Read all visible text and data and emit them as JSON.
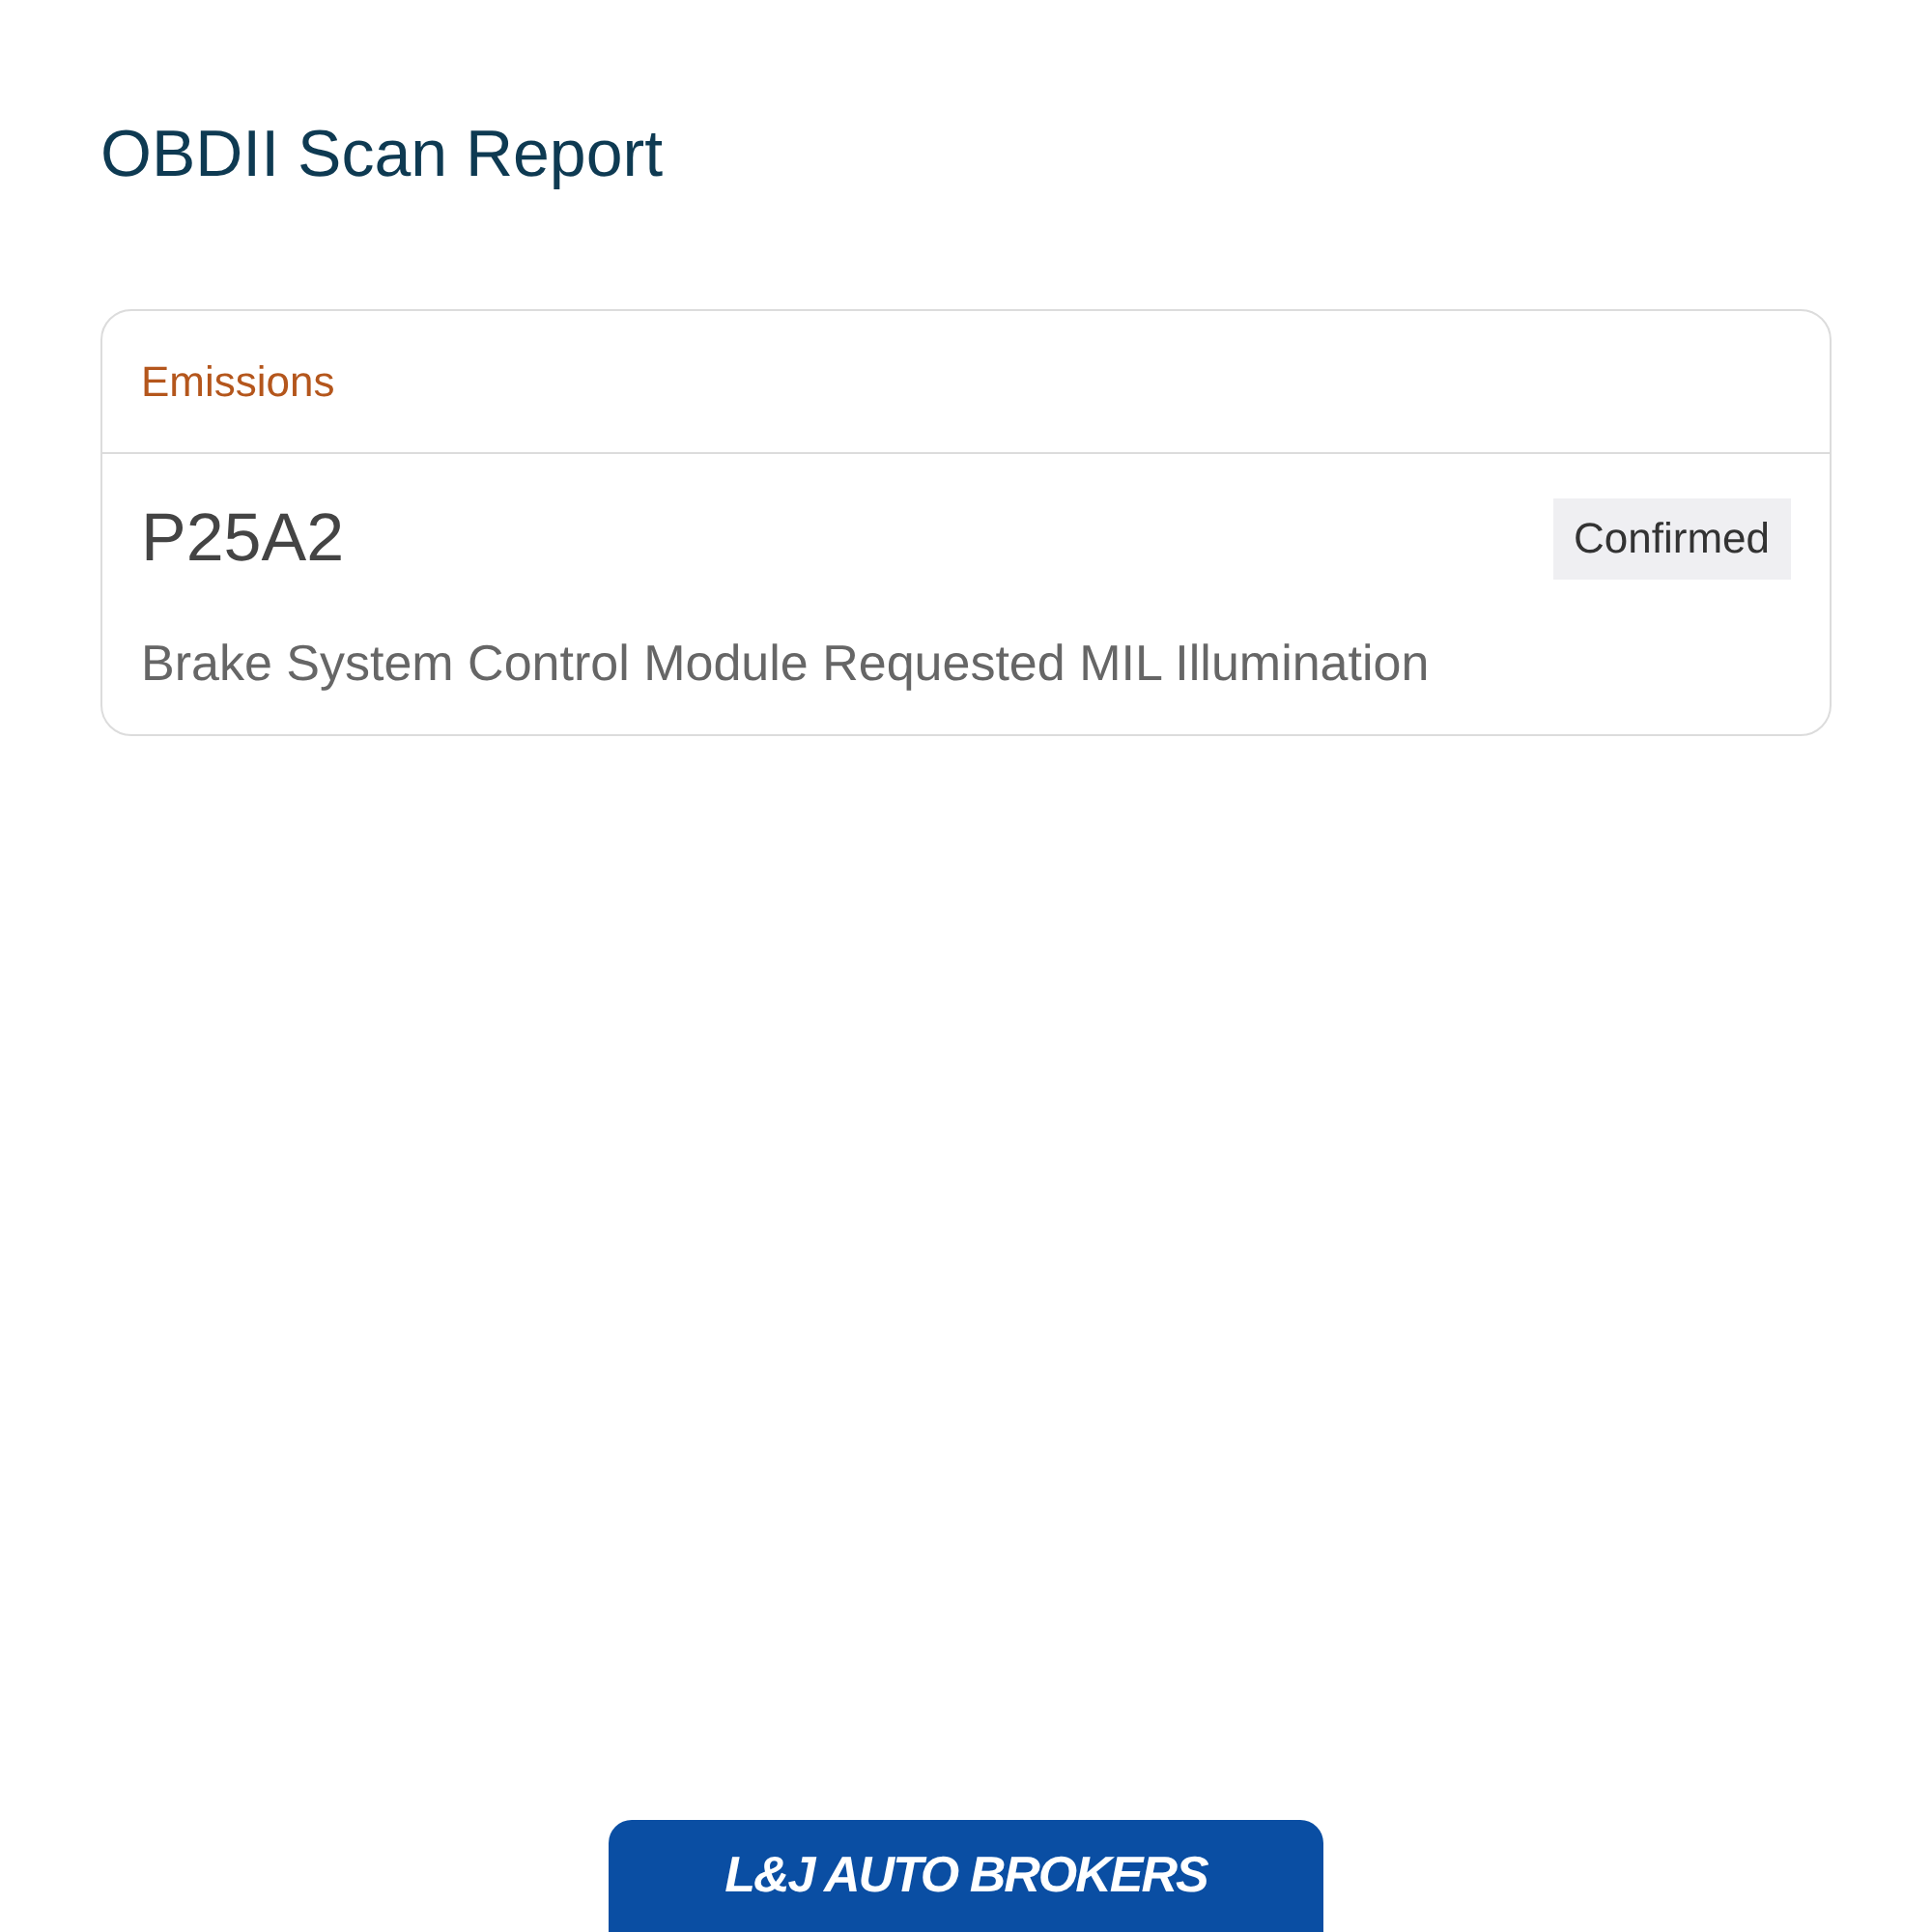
{
  "title": "OBDII Scan Report",
  "sections": [
    {
      "heading": "Emissions",
      "codes": [
        {
          "code": "P25A2",
          "status": "Confirmed",
          "description": "Brake System Control Module Requested MIL Illumination"
        }
      ]
    }
  ],
  "footer": {
    "logo_text": "L&J AUTO BROKERS"
  }
}
